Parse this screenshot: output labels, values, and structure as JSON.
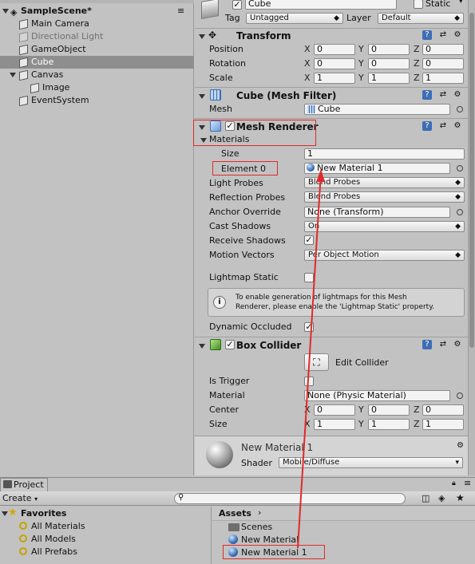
{
  "hierarchy": {
    "create_label": "Create",
    "scene_name": "SampleScene*",
    "items": [
      {
        "label": "Main Camera",
        "inactive": false,
        "selected": false
      },
      {
        "label": "Directional Light",
        "inactive": true,
        "selected": false
      },
      {
        "label": "GameObject",
        "inactive": false,
        "selected": false
      },
      {
        "label": "Cube",
        "inactive": false,
        "selected": true
      },
      {
        "label": "Canvas",
        "inactive": false,
        "selected": false
      },
      {
        "label": "Image",
        "inactive": false,
        "selected": false
      },
      {
        "label": "EventSystem",
        "inactive": false,
        "selected": false
      }
    ]
  },
  "inspector": {
    "object_name": "Cube",
    "static_label": "Static",
    "tag_label": "Tag",
    "tag_value": "Untagged",
    "layer_label": "Layer",
    "layer_value": "Default",
    "transform": {
      "title": "Transform",
      "rows": [
        {
          "label": "Position",
          "x": "0",
          "y": "0",
          "z": "0"
        },
        {
          "label": "Rotation",
          "x": "0",
          "y": "0",
          "z": "0"
        },
        {
          "label": "Scale",
          "x": "1",
          "y": "1",
          "z": "1"
        }
      ],
      "axes": [
        "X",
        "Y",
        "Z"
      ]
    },
    "mesh_filter": {
      "title": "Cube (Mesh Filter)",
      "mesh_label": "Mesh",
      "mesh_value": "Cube"
    },
    "mesh_renderer": {
      "title": "Mesh Renderer",
      "materials_label": "Materials",
      "size_label": "Size",
      "size_value": "1",
      "element_label": "Element 0",
      "element_value": "New Material 1",
      "rows": [
        {
          "label": "Light Probes",
          "value": "Blend Probes"
        },
        {
          "label": "Reflection Probes",
          "value": "Blend Probes"
        },
        {
          "label": "Anchor Override",
          "value": "None (Transform)"
        },
        {
          "label": "Cast Shadows",
          "value": "On"
        },
        {
          "label": "Receive Shadows",
          "value": ""
        },
        {
          "label": "Motion Vectors",
          "value": "Per Object Motion"
        }
      ],
      "lightmap_static_label": "Lightmap Static",
      "info_line1": "To enable generation of lightmaps for this Mesh",
      "info_line2": "Renderer, please enable the 'Lightmap Static' property.",
      "dynamic_occluded_label": "Dynamic Occluded"
    },
    "box_collider": {
      "title": "Box Collider",
      "edit_label": "Edit Collider",
      "is_trigger_label": "Is Trigger",
      "material_label": "Material",
      "material_value": "None (Physic Material)",
      "center": {
        "label": "Center",
        "x": "0",
        "y": "0",
        "z": "0"
      },
      "size": {
        "label": "Size",
        "x": "1",
        "y": "1",
        "z": "1"
      }
    },
    "material_preview": {
      "name": "New Material 1",
      "shader_label": "Shader",
      "shader_value": "Mobile/Diffuse"
    }
  },
  "project": {
    "tab_label": "Project",
    "create_label": "Create",
    "favorites_label": "Favorites",
    "favorites": [
      "All Materials",
      "All Models",
      "All Prefabs"
    ],
    "assets_label": "Assets",
    "assets": [
      "Scenes",
      "New Material",
      "New Material 1"
    ]
  },
  "colors": {
    "highlight": "#e02a2a",
    "selection": "#8e8e8e",
    "panel": "#c2c2c2"
  }
}
